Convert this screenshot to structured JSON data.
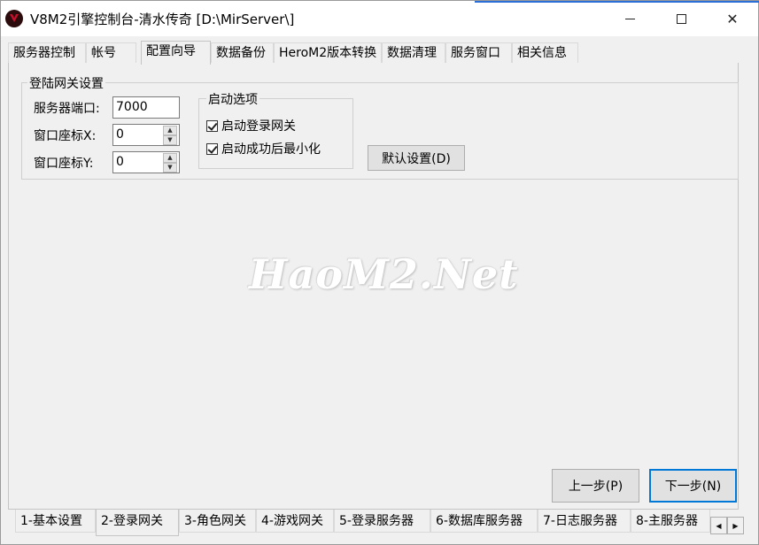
{
  "window": {
    "title": "V8M2引擎控制台-清水传奇 [D:\\MirServer\\]",
    "accent_color": "#2b6fd6"
  },
  "top_tabs": [
    "服务器控制",
    "帐号",
    "配置向导",
    "数据备份",
    "HeroM2版本转换",
    "数据清理",
    "服务窗口",
    "相关信息"
  ],
  "active_top_tab": "配置向导",
  "login_gateway": {
    "group_title": "登陆网关设置",
    "port_label": "服务器端口:",
    "port_value": "7000",
    "x_label": "窗口座标X:",
    "x_value": "0",
    "y_label": "窗口座标Y:",
    "y_value": "0",
    "options": {
      "group_title": "启动选项",
      "start_gateway_label": "启动登录网关",
      "start_gateway_checked": true,
      "minimize_label": "启动成功后最小化",
      "minimize_checked": true
    },
    "default_button": "默认设置(D)"
  },
  "watermark": "HaoM2.Net",
  "nav": {
    "prev_button": "上一步(P)",
    "next_button": "下一步(N)"
  },
  "bottom_tabs": [
    "1-基本设置",
    "2-登录网关",
    "3-角色网关",
    "4-游戏网关",
    "5-登录服务器",
    "6-数据库服务器",
    "7-日志服务器",
    "8-主服务器"
  ],
  "active_bottom_tab": "2-登录网关",
  "icons": [
    "app-logo-icon",
    "minimize-icon",
    "maximize-icon",
    "close-icon",
    "spin-up-icon",
    "spin-down-icon",
    "checkmark-icon",
    "scroll-left-icon",
    "scroll-right-icon"
  ]
}
